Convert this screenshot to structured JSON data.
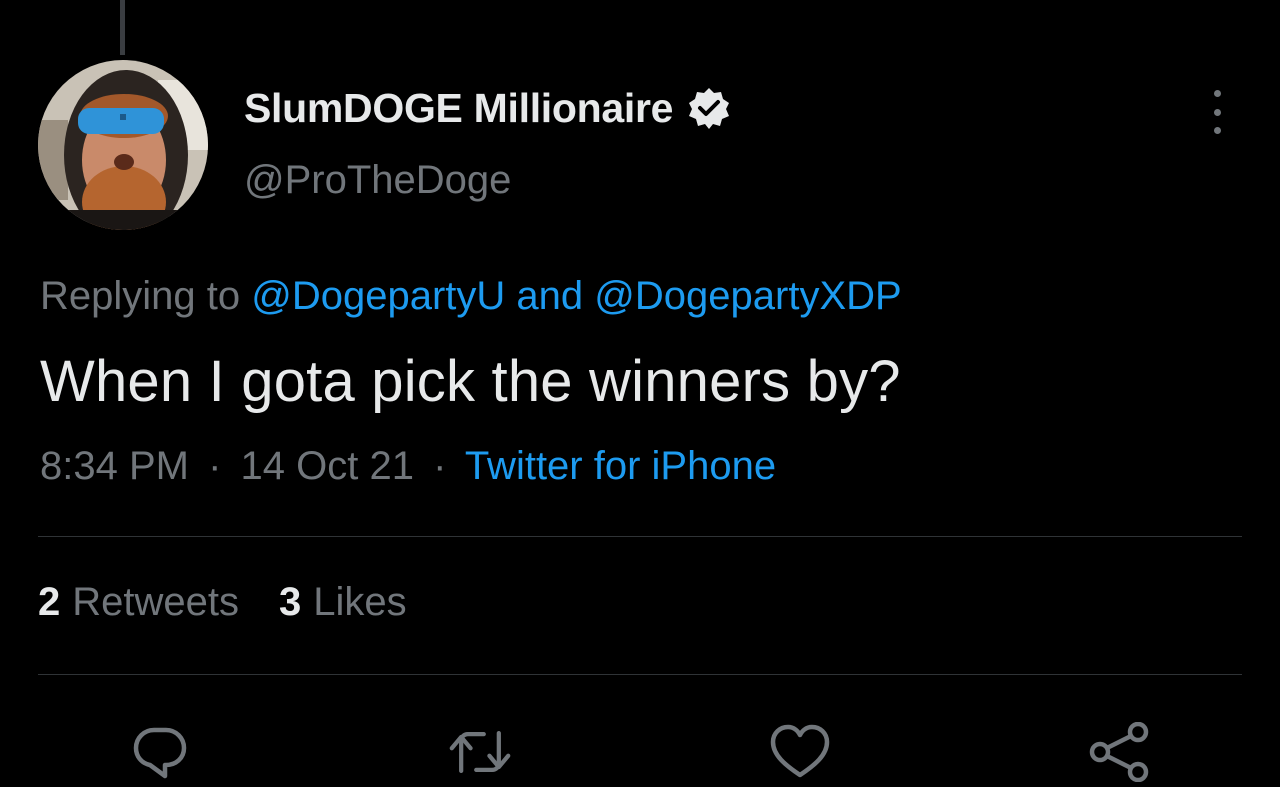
{
  "tweet": {
    "display_name": "SlumDOGE Millionaire",
    "handle": "@ProTheDoge",
    "replying_prefix": "Replying to",
    "replying_user_1": "@DogepartyU",
    "replying_and": "and",
    "replying_user_2": "@DogepartyXDP",
    "text": "When I gota pick the winners by?",
    "time": "8:34 PM",
    "separator": "·",
    "date": "14 Oct 21",
    "source": "Twitter for iPhone"
  },
  "stats": {
    "retweets_count": "2",
    "retweets_label": "Retweets",
    "likes_count": "3",
    "likes_label": "Likes"
  },
  "icons": {
    "verified": "verified-badge-icon",
    "more": "more-options-icon",
    "reply": "reply-icon",
    "retweet": "retweet-icon",
    "like": "heart-icon",
    "share": "share-icon"
  },
  "colors": {
    "background": "#000000",
    "text_primary": "#e7e9ea",
    "text_secondary": "#71767b",
    "link": "#1d9bf0",
    "divider": "#2f3336"
  }
}
